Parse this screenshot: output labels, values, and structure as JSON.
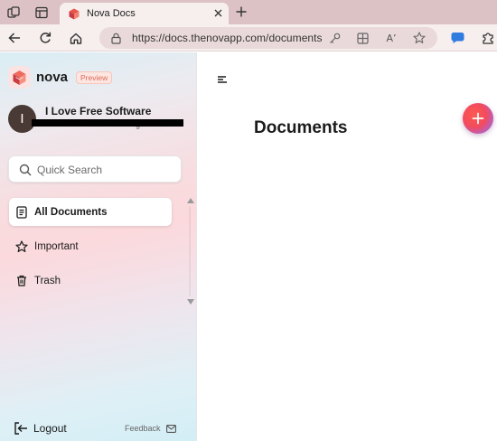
{
  "browser": {
    "tab": {
      "title": "Nova Docs"
    },
    "address": {
      "url": "https://docs.thenovapp.com/documents"
    },
    "omnibox_actions": {
      "reader_label": "A’"
    }
  },
  "sidebar": {
    "brand": {
      "name": "nova",
      "badge": "Preview"
    },
    "user": {
      "initial": "I",
      "name": "I Love Free Software",
      "email_tail": "g"
    },
    "search": {
      "placeholder": "Quick Search"
    },
    "items": [
      {
        "label": "All Documents",
        "icon": "document-icon",
        "active": true
      },
      {
        "label": "Important",
        "icon": "star-icon",
        "active": false
      },
      {
        "label": "Trash",
        "icon": "trash-icon",
        "active": false
      }
    ],
    "logout_label": "Logout",
    "feedback_label": "Feedback"
  },
  "main": {
    "title": "Documents"
  },
  "colors": {
    "accent": "#e06a5a",
    "fab_gradient": [
      "#ff5a4e",
      "#b262c9",
      "#5ba3e0"
    ],
    "tabstrip": "#dcc2c4",
    "toolbar": "#f7eeee"
  }
}
